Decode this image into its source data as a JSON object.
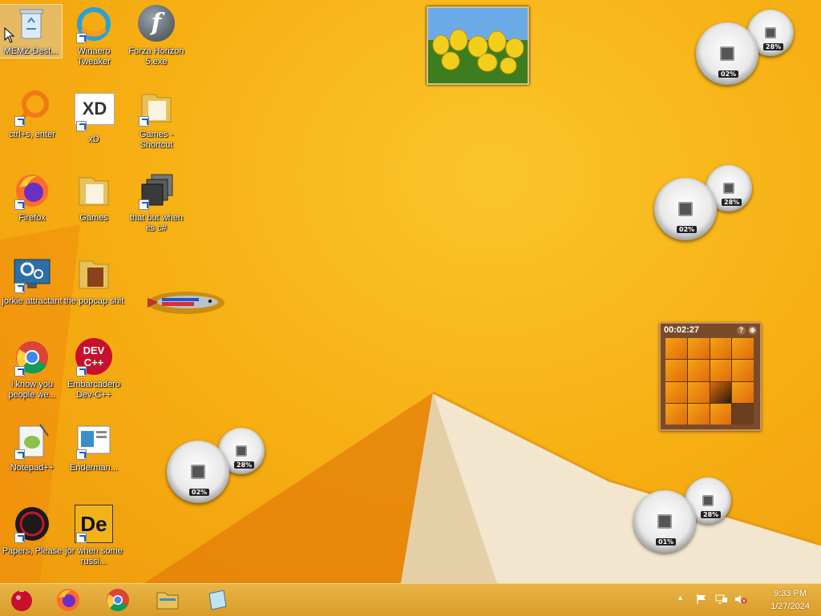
{
  "desktop": {
    "icons": [
      {
        "label": "MEMZ-Dest..."
      },
      {
        "label": "Winaero Tweaker"
      },
      {
        "label": "Forza Horizon 5.exe"
      },
      {
        "label": "ctrl+s, enter"
      },
      {
        "label": "xD"
      },
      {
        "label": "Games - Shortcut"
      },
      {
        "label": "Firefox"
      },
      {
        "label": "Games"
      },
      {
        "label": "that but when its c#"
      },
      {
        "label": "jorkie attractant"
      },
      {
        "label": "the popcap shit"
      },
      {
        "label": "i know you people we..."
      },
      {
        "label": "Embarcadero Dev-C++"
      },
      {
        "label": "Notepad++"
      },
      {
        "label": "Enderman..."
      },
      {
        "label": "Papers, Please"
      },
      {
        "label": "jor when some russi..."
      }
    ],
    "icon_text": {
      "xd_logo": "XD",
      "devcpp_logo_top": "DEV",
      "devcpp_logo_bottom": "C++",
      "de_logo": "De",
      "flash_logo": "f"
    }
  },
  "gadgets": {
    "cpu_meters": [
      {
        "cpu": "02%",
        "memory": "28%"
      },
      {
        "cpu": "02%",
        "memory": "28%"
      },
      {
        "cpu": "02%",
        "memory": "28%"
      },
      {
        "cpu": "01%",
        "memory": "28%"
      }
    ],
    "puzzle": {
      "timer": "00:02:27",
      "help": "?",
      "menu": "⊕"
    }
  },
  "taskbar": {
    "clock_time": "9:33 PM",
    "clock_date": "1/27/2024",
    "tray_chevron": "▴"
  },
  "colors": {
    "accent": "#f7b418",
    "taskbar": "#dfa534"
  }
}
